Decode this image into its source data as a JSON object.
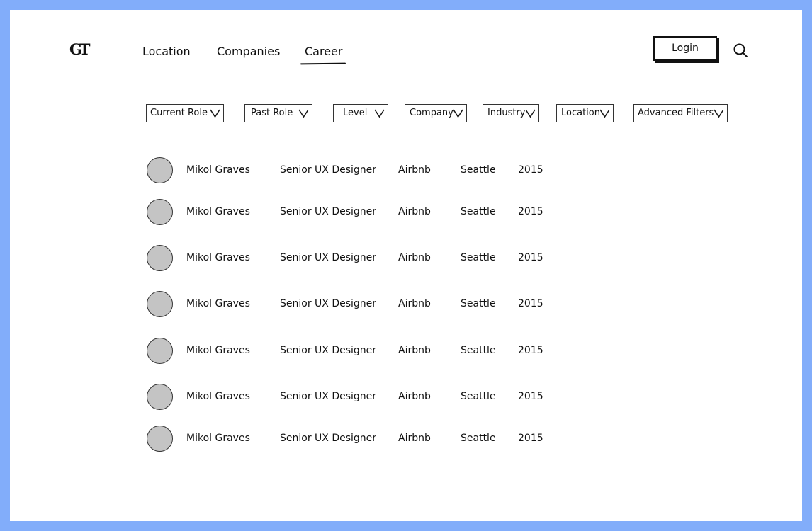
{
  "header": {
    "logo_text": "GT",
    "nav": [
      {
        "label": "Location"
      },
      {
        "label": "Companies"
      },
      {
        "label": "Career",
        "active": true
      }
    ],
    "login_label": "Login",
    "search_icon": "search-icon"
  },
  "filters": [
    {
      "label": "Current Role"
    },
    {
      "label": "Past Role"
    },
    {
      "label": "Level"
    },
    {
      "label": "Company"
    },
    {
      "label": "Industry"
    },
    {
      "label": "Location"
    },
    {
      "label": "Advanced Filters"
    }
  ],
  "results": [
    {
      "name": "Mikol Graves",
      "title": "Senior UX Designer",
      "company": "Airbnb",
      "city": "Seattle",
      "year": "2015"
    },
    {
      "name": "Mikol Graves",
      "title": "Senior UX Designer",
      "company": "Airbnb",
      "city": "Seattle",
      "year": "2015"
    },
    {
      "name": "Mikol Graves",
      "title": "Senior UX Designer",
      "company": "Airbnb",
      "city": "Seattle",
      "year": "2015"
    },
    {
      "name": "Mikol Graves",
      "title": "Senior UX Designer",
      "company": "Airbnb",
      "city": "Seattle",
      "year": "2015"
    },
    {
      "name": "Mikol Graves",
      "title": "Senior UX Designer",
      "company": "Airbnb",
      "city": "Seattle",
      "year": "2015"
    },
    {
      "name": "Mikol Graves",
      "title": "Senior UX Designer",
      "company": "Airbnb",
      "city": "Seattle",
      "year": "2015"
    },
    {
      "name": "Mikol Graves",
      "title": "Senior UX Designer",
      "company": "Airbnb",
      "city": "Seattle",
      "year": "2015"
    }
  ],
  "colors": {
    "page_background": "#82adfa",
    "canvas": "#ffffff",
    "avatar_fill": "#c4c4c4",
    "ink": "#111111"
  }
}
